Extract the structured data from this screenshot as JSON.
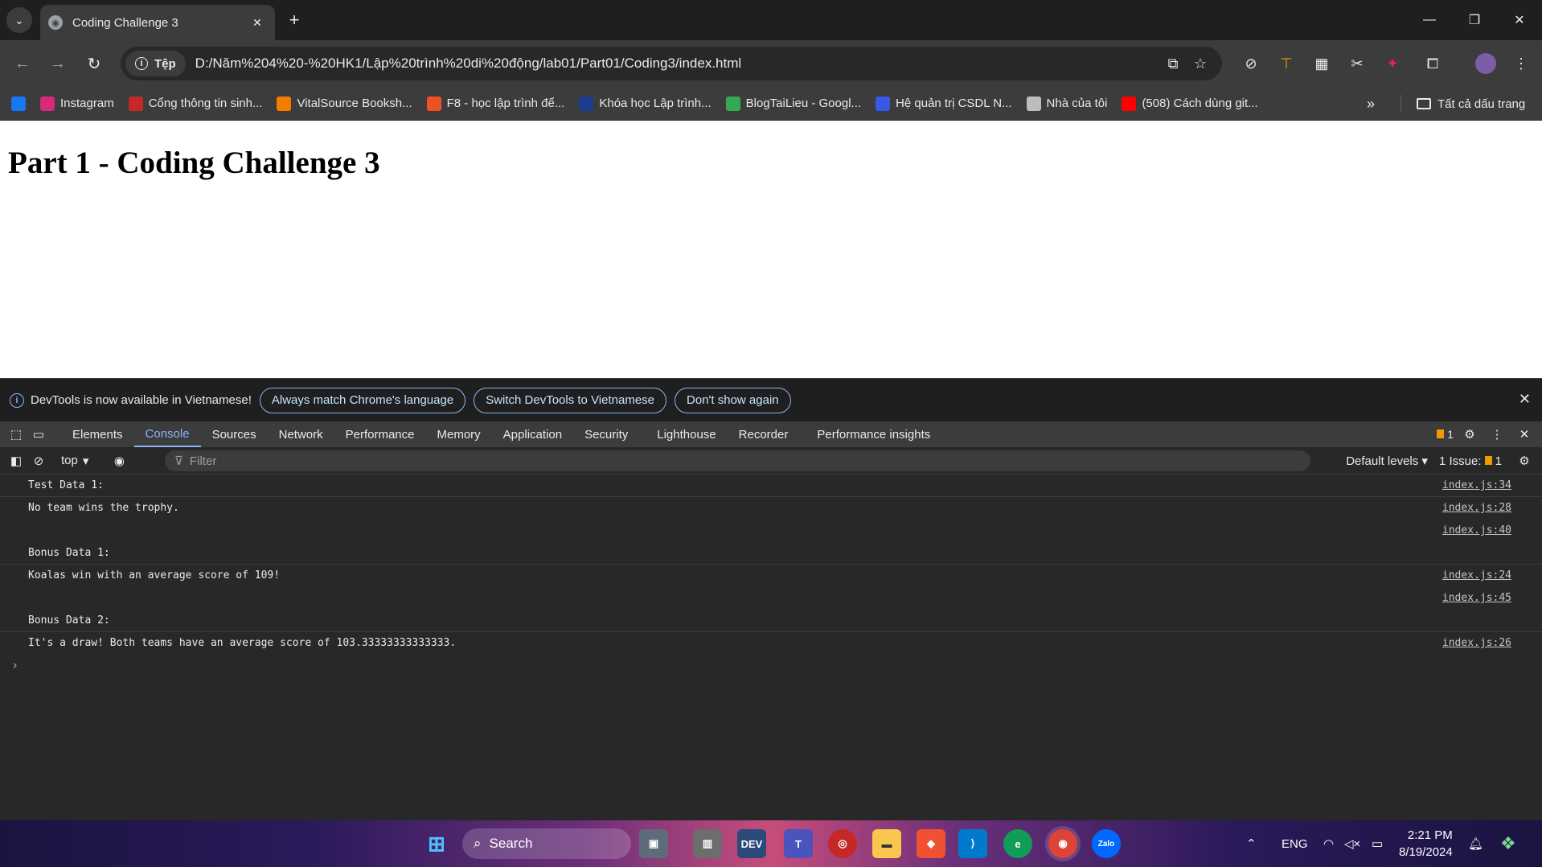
{
  "browser": {
    "tab_title": "Coding Challenge 3",
    "new_tab_symbol": "+",
    "security_chip": "Tệp",
    "url": "D:/Năm%204%20-%20HK1/Lập%20trình%20di%20động/lab01/Part01/Coding3/index.html"
  },
  "bookmarks": {
    "items": [
      {
        "label": "",
        "icon": "facebook-icon",
        "color": "#1877f2"
      },
      {
        "label": "Instagram",
        "icon": "instagram-icon",
        "color": "#d62976"
      },
      {
        "label": "Cổng thông tin sinh...",
        "icon": "portal-icon",
        "color": "#c62828"
      },
      {
        "label": "VitalSource Booksh...",
        "icon": "vitalsource-icon",
        "color": "#f57c00"
      },
      {
        "label": "F8 - học lập trình để...",
        "icon": "f8-icon",
        "color": "#f05123"
      },
      {
        "label": "Khóa học Lập trình...",
        "icon": "course-icon",
        "color": "#1a3d8f"
      },
      {
        "label": "BlogTaiLieu - Googl...",
        "icon": "google-drive-icon",
        "color": "#34a853"
      },
      {
        "label": "Hệ quản trị CSDL N...",
        "icon": "wordpress-icon",
        "color": "#3858e9"
      },
      {
        "label": "Nhà của tôi",
        "icon": "home-page-icon",
        "color": "#bdbdbd"
      },
      {
        "label": "(508) Cách dùng git...",
        "icon": "youtube-icon",
        "color": "#ff0000"
      }
    ],
    "more": "»",
    "all": "Tất cả dấu trang"
  },
  "page": {
    "heading": "Part 1 - Coding Challenge 3"
  },
  "devtools": {
    "banner": {
      "message": "DevTools is now available in Vietnamese!",
      "btn_match": "Always match Chrome's language",
      "btn_switch": "Switch DevTools to Vietnamese",
      "btn_dont_show": "Don't show again"
    },
    "tabs": [
      "Elements",
      "Console",
      "Sources",
      "Network",
      "Performance",
      "Memory",
      "Application",
      "Security",
      "Lighthouse",
      "Recorder",
      "Performance insights"
    ],
    "issue_count": "1",
    "context": "top",
    "filter_placeholder": "Filter",
    "levels": "Default levels",
    "issues_label": "1 Issue:",
    "issues_count": "1",
    "console_rows": [
      {
        "msg": "Test Data 1:",
        "src": "index.js:34",
        "bordered": true
      },
      {
        "msg": "No team wins the trophy.",
        "src": "index.js:28",
        "bordered": false
      },
      {
        "msg": "",
        "src": "index.js:40",
        "bordered": false
      },
      {
        "msg": "Bonus Data 1:",
        "src": "",
        "bordered": true
      },
      {
        "msg": "Koalas win with an average score of 109!",
        "src": "index.js:24",
        "bordered": false
      },
      {
        "msg": "",
        "src": "index.js:45",
        "bordered": false
      },
      {
        "msg": "Bonus Data 2:",
        "src": "",
        "bordered": true
      },
      {
        "msg": "It's a draw! Both teams have an average score of 103.33333333333333.",
        "src": "index.js:26",
        "bordered": false
      }
    ],
    "prompt": "›"
  },
  "taskbar": {
    "search_label": "Search",
    "lang": "ENG",
    "time": "2:21 PM",
    "date": "8/19/2024",
    "apps": [
      "windows-start-icon",
      "file-folder-icon",
      "photos-icon",
      "devc-icon",
      "teams-icon",
      "app-icon",
      "file-explorer-icon",
      "git-icon",
      "vscode-icon",
      "edge-icon",
      "chrome-icon",
      "zalo-icon"
    ]
  }
}
